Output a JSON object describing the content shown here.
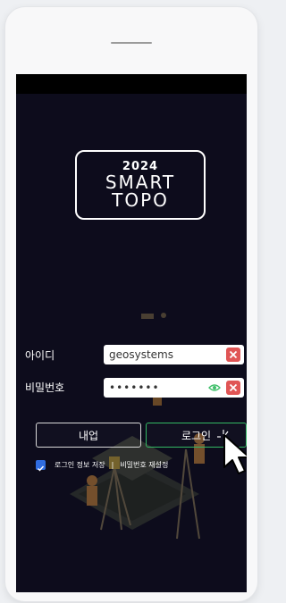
{
  "logo": {
    "year": "2024",
    "line1": "SMART",
    "line2": "TOPO"
  },
  "form": {
    "id_label": "아이디",
    "id_value": "geosystems",
    "pw_label": "비밀번호",
    "pw_value": "•••••••"
  },
  "buttons": {
    "signup": "내업",
    "login": "로그인"
  },
  "options": {
    "remember_label": "로그인 정보 저장",
    "separator": "|",
    "reset_password": "비밀번호 재설정",
    "remember_checked": true
  },
  "colors": {
    "background": "#0d0c1c",
    "clear_button": "#e05555",
    "login_border": "#33b864",
    "checkbox": "#2f6ce0",
    "eye_icon": "#3fbf6a"
  },
  "icons": {
    "clear": "close-icon",
    "visibility": "eye-icon",
    "cursor": "pointer-cursor-icon"
  }
}
